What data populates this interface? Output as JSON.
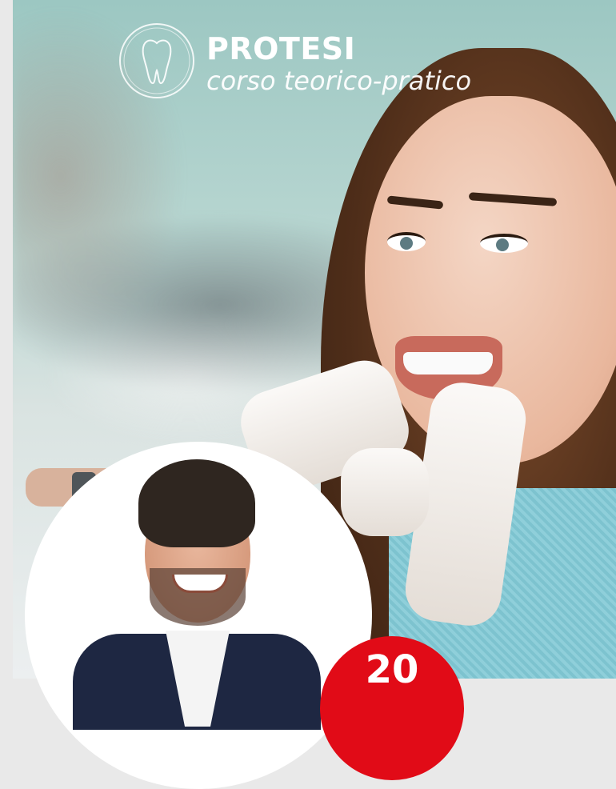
{
  "hero": {
    "title": "PROTESI",
    "subtitle": "corso teorico-pratico",
    "logo_icon": "tooth-logo-icon",
    "colors": {
      "title": "#ffffff",
      "badge": "#e10b17",
      "gown": "#8fcfda"
    }
  },
  "badge": {
    "text": "20"
  }
}
